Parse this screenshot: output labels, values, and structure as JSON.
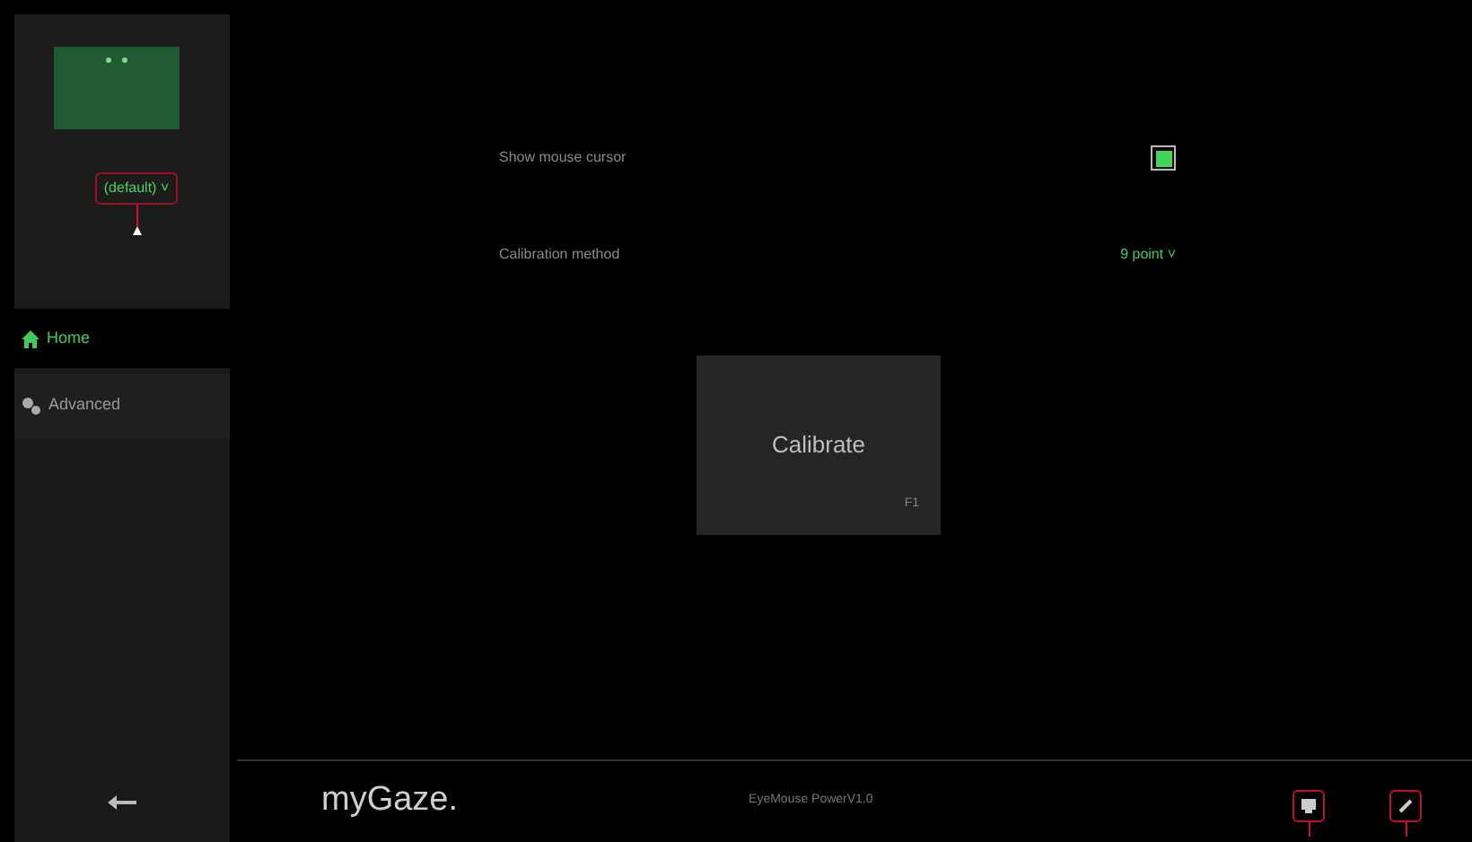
{
  "profile": {
    "label": "(default) ˅"
  },
  "nav": [
    {
      "label": "Home",
      "kind": "home",
      "selected": true
    },
    {
      "label": "Advanced",
      "kind": "settings",
      "selected": false
    }
  ],
  "settings": [
    {
      "kind": "checkbox",
      "label": "Show mouse cursor",
      "checked": true
    },
    {
      "kind": "dropdown",
      "label": "Calibration method",
      "value": "9 point ˅"
    }
  ],
  "calibrate": {
    "label": "Calibrate",
    "shortcut": "F1"
  },
  "footer": {
    "logo": "myGaze.",
    "version": "EyeMouse PowerV1.0"
  }
}
